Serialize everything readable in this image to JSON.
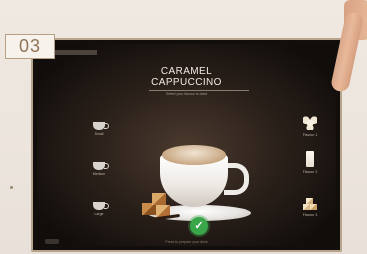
{
  "step": {
    "number": "03"
  },
  "screen": {
    "title_line1": "CARAMEL",
    "title_line2": "CAPPUCCINO",
    "subtitle": "Select your flavour to drink",
    "hint": "Press to prepare your drink",
    "sizes": [
      {
        "label": "Small"
      },
      {
        "label": "Medium"
      },
      {
        "label": "Large"
      }
    ],
    "flavours": [
      {
        "label": "Flavour 1",
        "icon": "vanilla-flower-icon"
      },
      {
        "label": "Flavour 2",
        "icon": "milk-glass-icon"
      },
      {
        "label": "Flavour 3",
        "icon": "sugar-cubes-icon"
      }
    ],
    "confirm_icon": "check-icon",
    "colors": {
      "confirm": "#3aa64a",
      "screen_bg": "#2a201a",
      "frame": "#b7a48c"
    }
  }
}
